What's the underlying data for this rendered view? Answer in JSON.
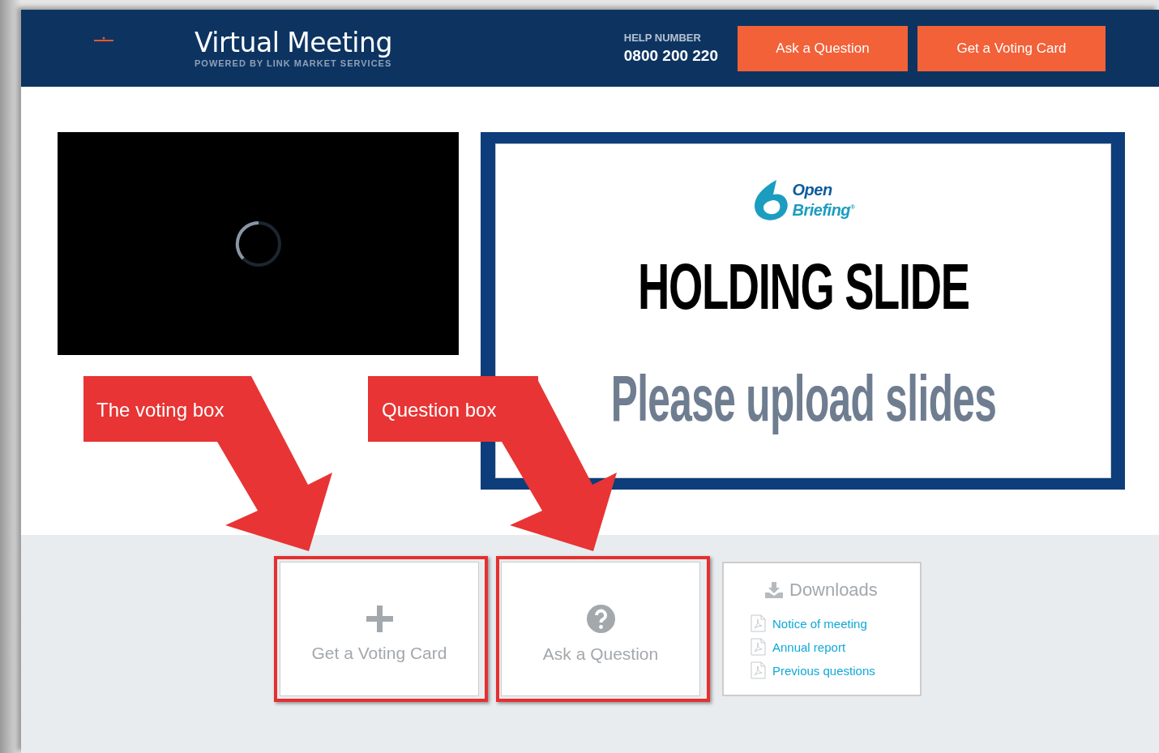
{
  "header": {
    "title": "Virtual Meeting",
    "subtitle": "POWERED BY LINK MARKET SERVICES",
    "help_label": "HELP NUMBER",
    "help_number": "0800 200 220",
    "buttons": [
      "Ask a Question",
      "Get a Voting Card"
    ]
  },
  "slide": {
    "logo_line_1": "Open",
    "logo_line_2": "Briefing$^{®}$",
    "heading": "HOLDING SLIDE",
    "subheading": "Please upload slides"
  },
  "tiles": [
    {
      "kind": "vote",
      "label": "Get a Voting Card"
    },
    {
      "kind": "question",
      "label": "Ask a Question"
    }
  ],
  "downloads": {
    "title": "Downloads",
    "links": [
      "Notice of meeting",
      "Annual report",
      "Previous questions"
    ]
  },
  "annotations": [
    {
      "label": "The voting box"
    },
    {
      "label": "Question box"
    }
  ]
}
